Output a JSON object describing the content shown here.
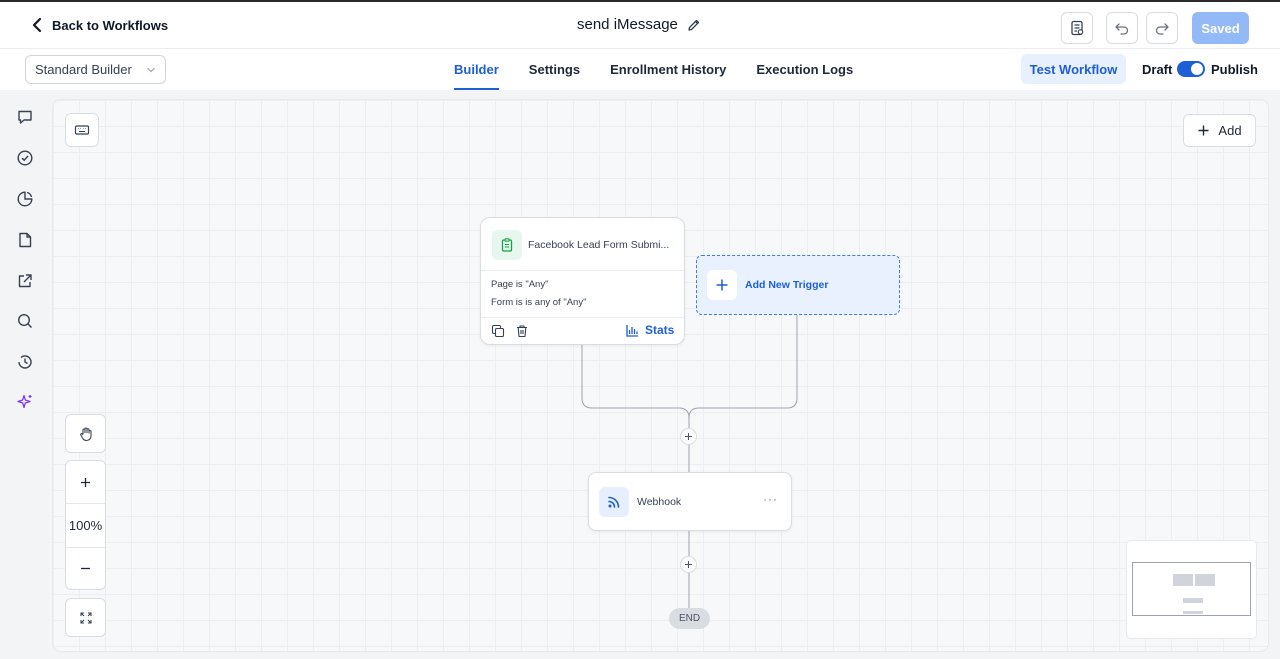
{
  "header": {
    "back_label": "Back to Workflows",
    "workflow_title": "send iMessage",
    "saved_label": "Saved"
  },
  "subbar": {
    "builder_mode": "Standard Builder",
    "tabs": [
      {
        "label": "Builder",
        "active": true
      },
      {
        "label": "Settings",
        "active": false
      },
      {
        "label": "Enrollment History",
        "active": false
      },
      {
        "label": "Execution Logs",
        "active": false
      }
    ],
    "test_label": "Test Workflow",
    "draft_label": "Draft",
    "publish_label": "Publish",
    "publish_toggle_on": true
  },
  "rail": {
    "icons": [
      "chat-icon",
      "check-circle-icon",
      "pie-chart-icon",
      "file-icon",
      "external-link-icon",
      "search-icon",
      "history-icon",
      "sparkles-icon"
    ]
  },
  "canvas": {
    "add_label": "Add",
    "zoom_level": "100%",
    "trigger": {
      "title": "Facebook Lead Form Submi...",
      "conditions": [
        "Page is \"Any\"",
        "Form is is any of \"Any\""
      ],
      "stats_label": "Stats"
    },
    "new_trigger_label": "Add New Trigger",
    "action": {
      "label": "Webhook",
      "more": "···"
    },
    "end_label": "END"
  },
  "colors": {
    "accent": "#1d5fd6",
    "saved_bg": "#93b9f7",
    "trigger_icon_bg": "#e7f7ee",
    "trigger_icon": "#16a34a",
    "sparkle": "#7c3aed"
  }
}
